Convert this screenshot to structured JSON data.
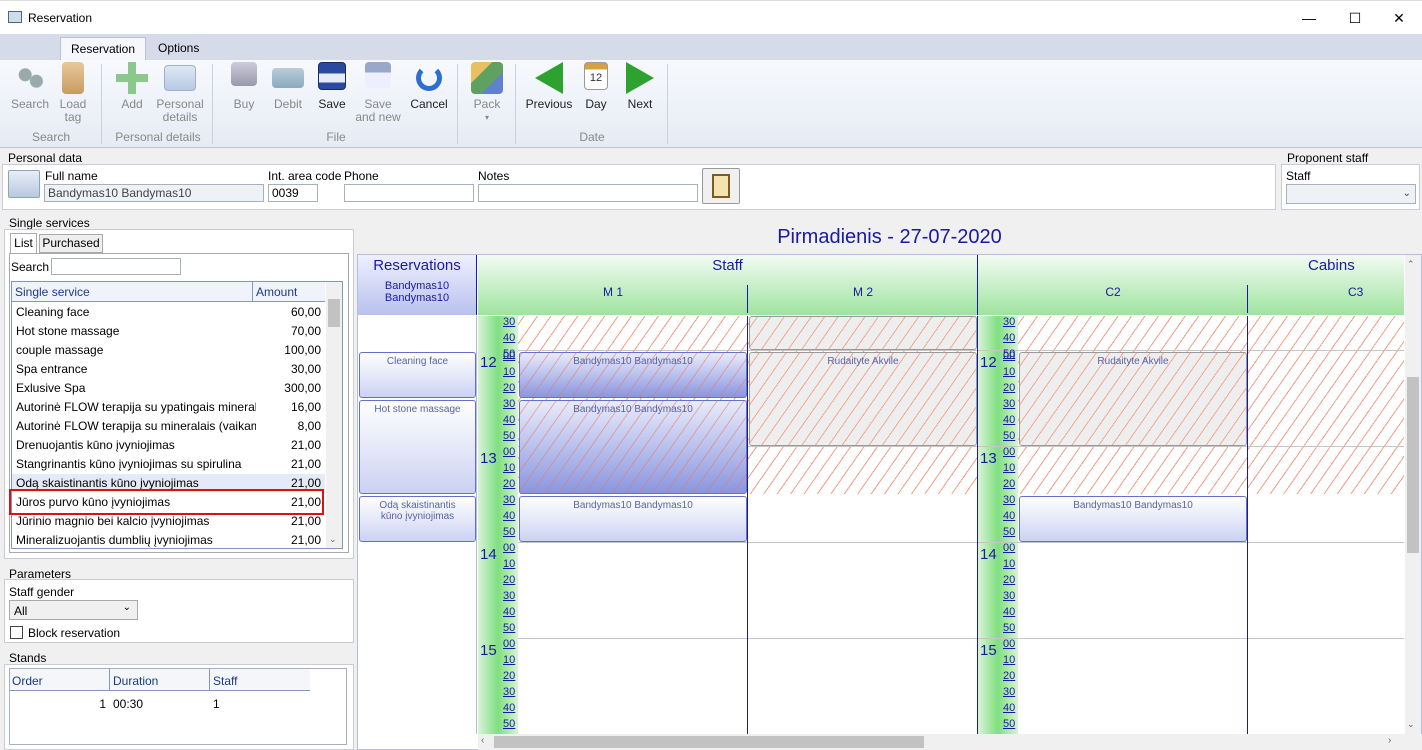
{
  "window": {
    "title": "Reservation",
    "minimize": "—",
    "maximize": "☐",
    "close": "✕"
  },
  "ribbon_tabs": [
    "Reservation",
    "Options"
  ],
  "ribbon": {
    "search": {
      "label": "Search"
    },
    "load_tag": {
      "label": "Load\ntag"
    },
    "add": {
      "label": "Add"
    },
    "personal_details": {
      "label": "Personal\ndetails"
    },
    "buy": {
      "label": "Buy"
    },
    "debit": {
      "label": "Debit"
    },
    "save": {
      "label": "Save"
    },
    "save_new": {
      "label": "Save\nand new"
    },
    "cancel": {
      "label": "Cancel"
    },
    "pack": {
      "label": "Pack"
    },
    "previous": {
      "label": "Previous"
    },
    "day": {
      "label": "Day"
    },
    "next": {
      "label": "Next"
    },
    "groups": [
      "Search",
      "Personal details",
      "File",
      "Date"
    ]
  },
  "personal": {
    "section": "Personal data",
    "fullname_label": "Full name",
    "fullname": "Bandymas10 Bandymas10",
    "area_label": "Int. area code",
    "area": "0039",
    "phone_label": "Phone",
    "phone": "",
    "notes_label": "Notes",
    "notes": ""
  },
  "proponent": {
    "section": "Proponent staff",
    "staff_label": "Staff",
    "staff": ""
  },
  "services": {
    "section": "Single services",
    "tabs": [
      "List",
      "Purchased"
    ],
    "search_label": "Search",
    "col_name": "Single service",
    "col_amount": "Amount",
    "rows": [
      {
        "name": "Cleaning face",
        "amount": "60,00"
      },
      {
        "name": "Hot stone massage",
        "amount": "70,00"
      },
      {
        "name": "couple massage",
        "amount": "100,00"
      },
      {
        "name": "Spa entrance",
        "amount": "30,00"
      },
      {
        "name": "Exlusive Spa",
        "amount": "300,00"
      },
      {
        "name": "Autorinė FLOW terapija su ypatingais mineral",
        "amount": "16,00"
      },
      {
        "name": "Autorinė FLOW terapija su mineralais (vaikam",
        "amount": "8,00"
      },
      {
        "name": "Drenuojantis kūno įvyniojimas",
        "amount": "21,00"
      },
      {
        "name": "Stangrinantis kūno įvyniojimas su spirulina",
        "amount": "21,00"
      },
      {
        "name": "Odą skaistinantis kūno įvyniojimas",
        "amount": "21,00"
      },
      {
        "name": "Jūros purvo kūno įvyniojimas",
        "amount": "21,00"
      },
      {
        "name": "Jūrinio magnio bei kalcio įvyniojimas",
        "amount": "21,00"
      },
      {
        "name": "Mineralizuojantis dumblių įvyniojimas",
        "amount": "21,00"
      }
    ]
  },
  "parameters": {
    "section": "Parameters",
    "gender_label": "Staff gender",
    "gender": "All",
    "block_label": "Block reservation"
  },
  "stands": {
    "section": "Stands",
    "cols": [
      "Order",
      "Duration",
      "Staff"
    ],
    "row": {
      "order": "1",
      "duration": "00:30",
      "staff": "1"
    }
  },
  "calendar": {
    "date_title": "Pirmadienis - 27-07-2020",
    "res_header": "Reservations",
    "res_client": "Bandymas10\nBandymas10",
    "staff_header": "Staff",
    "cabins_header": "Cabins",
    "staff_cols": [
      "M 1",
      "M 2"
    ],
    "cabin_cols": [
      "C2",
      "C3"
    ],
    "res_items": [
      "Cleaning face",
      "Hot stone massage",
      "Odą skaistinantis\nkūno įvyniojimas"
    ],
    "bookings": {
      "m1_a": "Bandymas10 Bandymas10",
      "m1_b": "Bandymas10 Bandymas10",
      "m1_c": "Bandymas10 Bandymas10",
      "m2_a": "Rudaityte Akvile",
      "c2_a": "Rudaityte Akvile",
      "c2_b": "Bandymas10 Bandymas10"
    },
    "hours": [
      "12",
      "13",
      "14",
      "15"
    ],
    "minutes": [
      "00",
      "10",
      "20",
      "30",
      "40",
      "50"
    ],
    "top_minutes": [
      "30",
      "40",
      "50"
    ]
  }
}
